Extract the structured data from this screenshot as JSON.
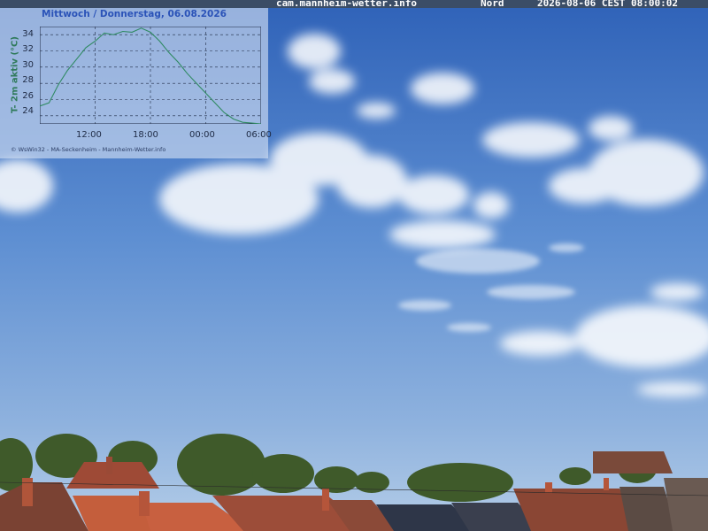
{
  "header": {
    "site": "cam.mannheim-wetter.info",
    "direction": "Nord",
    "timestamp": "2026-08-06 CEST 08:00:02"
  },
  "chart_panel": {
    "title": "Mittwoch / Donnerstag, 06.08.2026",
    "credit": "© WsWin32 - MA-Seckenheim - Mannheim-Wetter.info"
  },
  "chart_data": {
    "type": "line",
    "title": "Mittwoch / Donnerstag, 06.08.2026",
    "ylabel": "T- 2m aktiv (°C)",
    "xlabel": "",
    "ylim": [
      23,
      35
    ],
    "yticks": [
      "34",
      "32",
      "30",
      "28",
      "26",
      "24"
    ],
    "xticks": [
      "12:00",
      "18:00",
      "00:00",
      "06:00"
    ],
    "grid": true,
    "color": "#2f8a62",
    "series": [
      {
        "x": [
          6.0,
          7.0,
          8.0,
          9.0,
          10.0,
          11.0,
          12.0,
          13.0,
          14.0,
          15.0,
          16.0,
          17.0,
          18.0,
          19.0,
          20.0,
          21.0,
          22.0,
          23.0,
          24.0,
          25.0,
          26.0,
          27.0,
          28.0,
          29.0,
          30.0
        ],
        "y": [
          25.2,
          25.6,
          27.8,
          29.6,
          31.0,
          32.4,
          33.2,
          34.2,
          34.0,
          34.4,
          34.3,
          34.8,
          34.3,
          33.2,
          31.8,
          30.6,
          29.2,
          28.0,
          26.8,
          25.6,
          24.4,
          23.6,
          23.2,
          23.1,
          23.0
        ]
      }
    ]
  },
  "colors": {
    "sky_top": "#2f62b8",
    "sky_bottom": "#a9c6e6",
    "roof": "#b5553a"
  }
}
